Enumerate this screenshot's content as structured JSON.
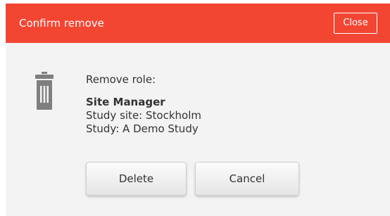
{
  "dialog": {
    "title": "Confirm remove",
    "close_label": "Close",
    "prompt": "Remove role:",
    "role_name": "Site Manager",
    "study_site": "Study site: Stockholm",
    "study": "Study: A Demo Study",
    "delete_label": "Delete",
    "cancel_label": "Cancel",
    "icon": "trash-icon"
  },
  "colors": {
    "header_bg": "#f24633",
    "dialog_bg": "#f3f3f3",
    "icon": "#7f7f7f",
    "text": "#333333"
  }
}
